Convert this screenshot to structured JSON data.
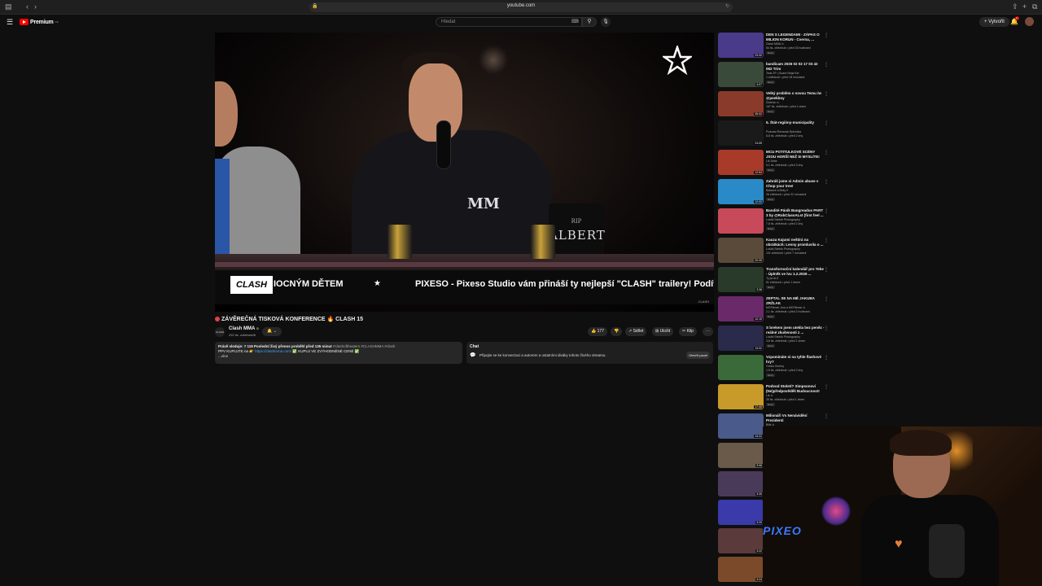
{
  "browser": {
    "url": "youtube.com"
  },
  "header": {
    "logo_text": "Premium",
    "logo_sup": "CZ",
    "search_placeholder": "Hledat",
    "create_label": "Vytvořit",
    "bell_badge": "9+"
  },
  "player": {
    "ticker_logo": "CLASH",
    "ticker_text_1": "IOCNÝM DĚTEM",
    "ticker_star": "★",
    "ticker_text_2": "PIXESO - Pixeso Studio vám přináší ty nejlepší \"CLASH\" trailery! Podíve",
    "rip_small": "RIP",
    "rip_big": "ALBERT",
    "shirt_logo": "MM",
    "watermark": "CLASH"
  },
  "video": {
    "title": "ZÁVĚREČNÁ TISKOVÁ KONFERENCE 🔥 CLASH 15",
    "channel_avatar_text": "CLASH",
    "channel_name": "Clash MMA",
    "channel_verified": "⊙",
    "channel_subs": "292 tis. odběratelů",
    "bell_subscribe": "🔔 ⌄",
    "like_count": "👍 177",
    "dislike": "👎",
    "share": "↗ Sdílet",
    "save": "⊞ Uložit",
    "clip": "✂ Klip",
    "more": "⋯"
  },
  "description": {
    "line1_bold": "Právě sleduje: 7 119  Poslední živý přenos proběhl před 135 minut",
    "line1_tags": " #clashoftheaters #CLASHMMA #clash",
    "line2_pre": "PPV KUPUJTE na 👉 ",
    "line2_link": "https://clashmma.com/",
    "line2_post": " ✅ KUPUJ VE ZVÝHODNĚNÉ CENĚ ✅",
    "more": "...více"
  },
  "chat": {
    "title": "Chat",
    "message": "Připojte se ke konverzaci a autorem a ostatními diváky tohoto živého streamu.",
    "open_label": "Otevřít panel",
    "icon": "💬"
  },
  "recommendations": [
    {
      "title": "DEN S LEGENDAMI - ZÁPAS O MILION KORUN - Cverna, ...",
      "channel": "Clash MMA ⊙",
      "meta": "84 tis. zhlédnutí • před 33 hodinami",
      "badge": "Nový",
      "duration": "23:32",
      "color": "#4a3a8a"
    },
    {
      "title": "bandicam 2026 02 02 17 03 42 062 Trim",
      "channel": "Tank ZP | Guard Ninja Kid",
      "meta": "1 zhlédnutí • před 18 minutami",
      "badge": "Nový",
      "duration": "4:07",
      "color": "#3a4a3a"
    },
    {
      "title": "Velký problém s novou Temu /w @peekboy",
      "channel": "Dobrick ⊙",
      "meta": "167 tis. zhlédnutí • před 1 dnem",
      "badge": "Nový",
      "duration": "35:02",
      "color": "#8a3a2a"
    },
    {
      "title": "5. Štát-regióny-municipality",
      "channel": "Podcast Richarda Rybníčka",
      "meta": "8,8 tis. zhlédnutí • před 2 dny",
      "badge": "",
      "duration": "24:05",
      "color": "#1a1a1a"
    },
    {
      "title": "MCU POTITULKOVÉ SCÉNY JSOU HORŠÍ NEŽ SI MYSLÍTE!",
      "channel": "Lik Sebe",
      "meta": "5,1 tis. zhlédnutí • před 3 dny",
      "badge": "Nový",
      "duration": "12:54",
      "color": "#a83a2a"
    },
    {
      "title": "Zahrálí jsme si Admin abuse v Chop your tree!",
      "channel": "Balanze a Moty II",
      "meta": "26 zhlédnutí • před 22 minutami",
      "badge": "Nový",
      "duration": "12:00",
      "color": "#2a8ac8"
    },
    {
      "title": "Bandité Páník Bangreadus PART 3 by @RobClassALst (first feel ...",
      "channel": "Lukáš Steiník Photography",
      "meta": "7,8 tis. zhlédnutí • před 2 dny",
      "badge": "Nový",
      "duration": "",
      "color": "#c84a5a"
    },
    {
      "title": "Kauza Kajumi neštírá na obrátkách: Lenny promluvila o ...",
      "channel": "Lukáš Steiník Photography",
      "meta": "101 zhlédnutí • před 7 minutami",
      "badge": "",
      "duration": "20:30",
      "color": "#5a4a3a"
    },
    {
      "title": "Transformoční kalendář pro Tebe - Úplněk ve lvu 1.2.2026 ...",
      "channel": "Ty jsi ALŽ",
      "meta": "81 zhlédnutí • před 1 dnem",
      "badge": "Nový",
      "duration": "3:36",
      "color": "#2a3a2a"
    },
    {
      "title": "ZEPTAL SE NA MĚ JAKUBA ZRŽLAK",
      "channel": "MGFitman Jura a MGFitman ⊙",
      "meta": "2,1 tis. zhlédnutí • před 2 hodinami",
      "badge": "Nový",
      "duration": "12:10",
      "color": "#6a2a6a"
    },
    {
      "title": "S brekem jsem utekla bez peněz - reálné zkušenosti z ...",
      "channel": "Lukáš Steiník Photography",
      "meta": "3,8 tis. zhlédnutí • před 1 dnem",
      "badge": "Nový",
      "duration": "13:31",
      "color": "#2a2a4a"
    },
    {
      "title": "Vzpomínáte si na tyhle flashové hry?",
      "channel": "Ondra Oceňuj",
      "meta": "1,5 tis. zhlédnutí • před 2 dny",
      "badge": "Nový",
      "duration": "",
      "color": "#3a6a3a"
    },
    {
      "title": "Podvod Století? Simpsonovi (Ne)předpověděli Budoucnost!",
      "channel": "Lik ⊙",
      "meta": "39 tis. zhlédnutí • před 1 dnem",
      "badge": "Nový",
      "duration": "17:40",
      "color": "#c89a2a"
    },
    {
      "title": "Milionáři Vs Nenávidění Prezidenti",
      "channel": "Bilik ⊙",
      "meta": "",
      "badge": "",
      "duration": "13:21",
      "color": "#4a5a8a"
    }
  ],
  "plain_thumbs": [
    {
      "duration": "3:06",
      "color": "#6a5a4a"
    },
    {
      "duration": "3:30",
      "color": "#4a3a5a"
    },
    {
      "duration": "3:29",
      "color": "#3a3aaa"
    },
    {
      "duration": "3:22",
      "color": "#5a3a3a"
    },
    {
      "duration": "3:24",
      "color": "#7a4a2a"
    }
  ],
  "webcam": {
    "neon_text": "PIXEO"
  }
}
